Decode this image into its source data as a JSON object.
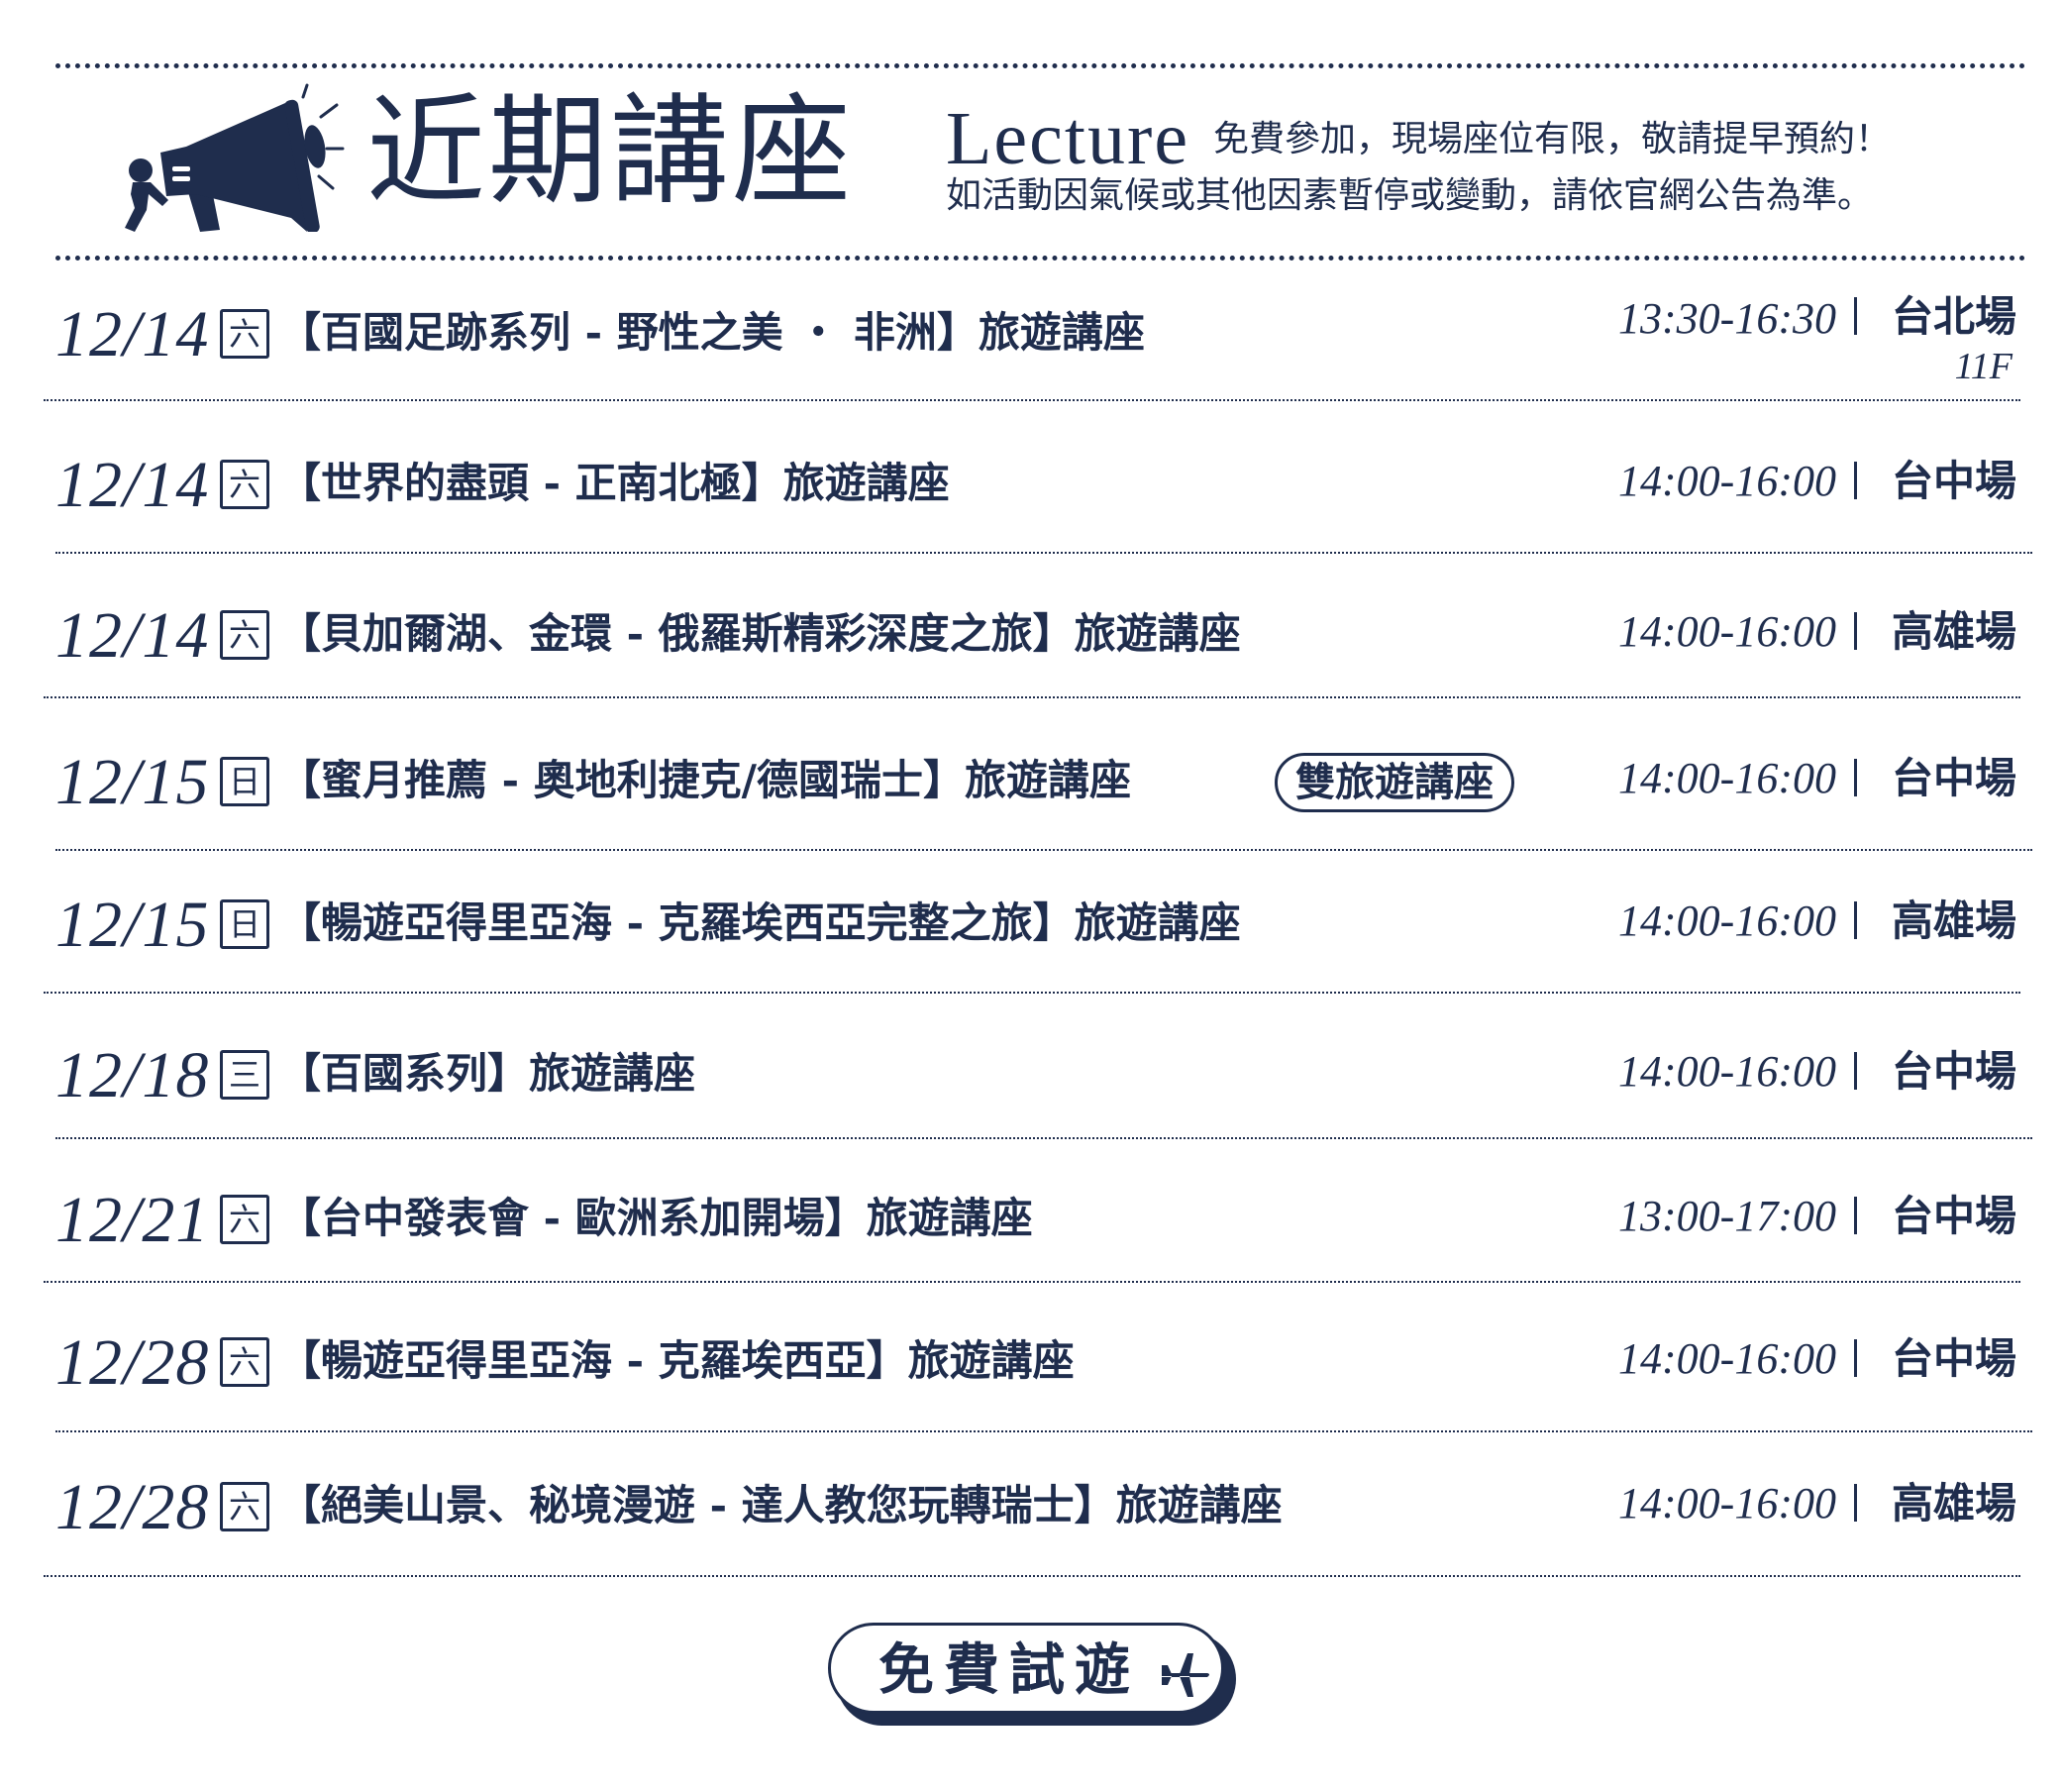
{
  "header": {
    "title": "近期講座",
    "lecture_word": "Lecture",
    "note_line1": "免費參加，現場座位有限，敬請提早預約！",
    "note_line2": "如活動因氣候或其他因素暫停或變動，請依官網公告為準。"
  },
  "lectures": [
    {
      "date": "12/14",
      "day": "六",
      "title": "【百國足跡系列 - 野性之美 ・ 非洲】旅遊講座",
      "time": "13:30-16:30",
      "venue": "台北場",
      "floor": "11F"
    },
    {
      "date": "12/14",
      "day": "六",
      "title": "【世界的盡頭 - 正南北極】旅遊講座",
      "time": "14:00-16:00",
      "venue": "台中場"
    },
    {
      "date": "12/14",
      "day": "六",
      "title": "【貝加爾湖、金環 - 俄羅斯精彩深度之旅】旅遊講座",
      "time": "14:00-16:00",
      "venue": "高雄場"
    },
    {
      "date": "12/15",
      "day": "日",
      "title": "【蜜月推薦 - 奧地利捷克/德國瑞士】旅遊講座",
      "badge": "雙旅遊講座",
      "time": "14:00-16:00",
      "venue": "台中場"
    },
    {
      "date": "12/15",
      "day": "日",
      "title": "【暢遊亞得里亞海 - 克羅埃西亞完整之旅】旅遊講座",
      "time": "14:00-16:00",
      "venue": "高雄場"
    },
    {
      "date": "12/18",
      "day": "三",
      "title": "【百國系列】旅遊講座",
      "time": "14:00-16:00",
      "venue": "台中場"
    },
    {
      "date": "12/21",
      "day": "六",
      "title": "【台中發表會 - 歐洲系加開場】旅遊講座",
      "time": "13:00-17:00",
      "venue": "台中場"
    },
    {
      "date": "12/28",
      "day": "六",
      "title": "【暢遊亞得里亞海 - 克羅埃西亞】旅遊講座",
      "time": "14:00-16:00",
      "venue": "台中場"
    },
    {
      "date": "12/28",
      "day": "六",
      "title": "【絕美山景、秘境漫遊 - 達人教您玩轉瑞士】旅遊講座",
      "time": "14:00-16:00",
      "venue": "高雄場"
    }
  ],
  "cta": {
    "label": "免費試遊"
  },
  "colors": {
    "primary": "#1f2d4d",
    "background": "#ffffff"
  },
  "icons": {
    "megaphone": "megaphone-icon",
    "plane": "airplane-icon"
  }
}
